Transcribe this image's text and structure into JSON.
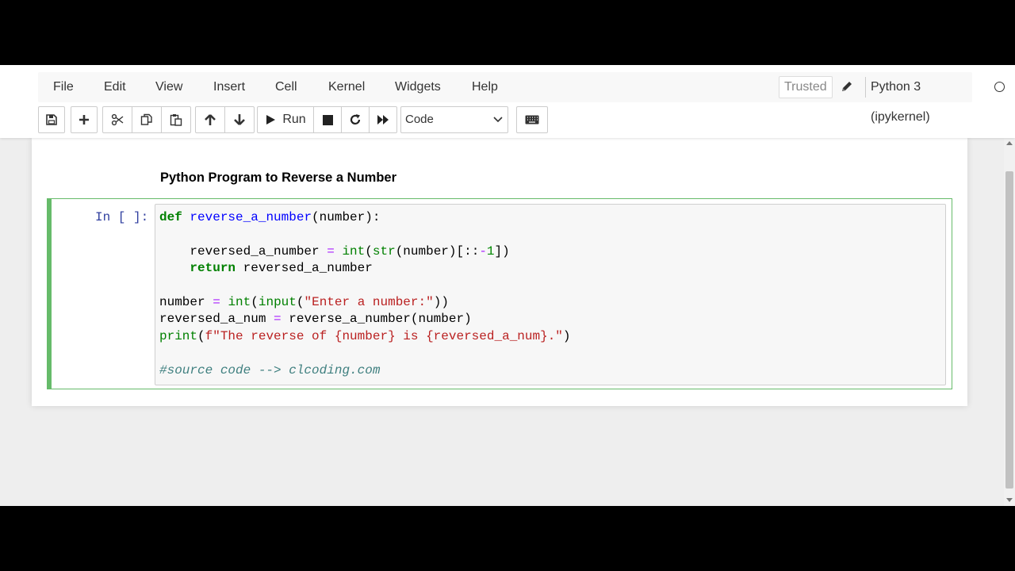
{
  "menu": [
    "File",
    "Edit",
    "View",
    "Insert",
    "Cell",
    "Kernel",
    "Widgets",
    "Help"
  ],
  "trusted_label": "Trusted",
  "kernel_name": "Python 3 (ipykernel)",
  "toolbar": {
    "run_label": "Run",
    "cell_type_value": "Code",
    "icons": [
      "save-icon",
      "plus-icon",
      "cut-icon",
      "copy-icon",
      "paste-icon",
      "arrow-up-icon",
      "arrow-down-icon",
      "play-icon",
      "stop-icon",
      "restart-icon",
      "fast-forward-icon",
      "keyboard-icon"
    ]
  },
  "markdown_cell": {
    "heading": "Python Program to Reverse a Number"
  },
  "code_cell": {
    "prompt": "In [ ]:",
    "lines": [
      "def reverse_a_number(number):",
      "",
      "    reversed_a_number = int(str(number)[::-1])",
      "    return reversed_a_number",
      "",
      "number = int(input(\"Enter a number:\"))",
      "reversed_a_num = reverse_a_number(number)",
      "print(f\"The reverse of {number} is {reversed_a_num}.\")",
      "",
      "#source code --> clcoding.com"
    ]
  },
  "colors": {
    "keyword": "#008000",
    "function_name": "#0000ff",
    "operator": "#aa22ff",
    "string": "#ba2121",
    "comment": "#408080",
    "cell_border_active": "#66bb6a",
    "prompt": "#303f9f"
  }
}
